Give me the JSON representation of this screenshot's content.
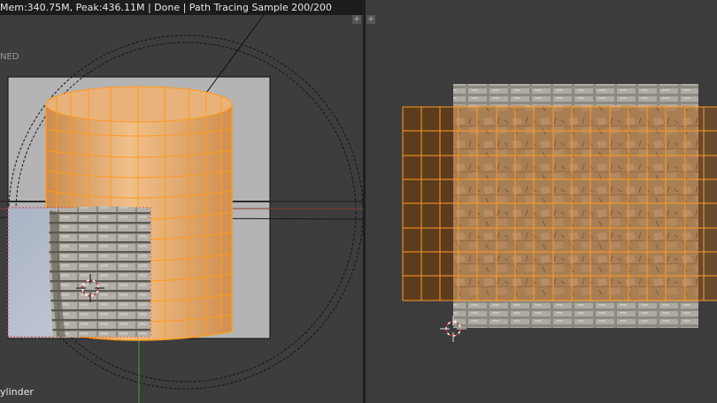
{
  "status_bar": {
    "text": "Mem:340.75M, Peak:436.11M | Done | Path Tracing Sample 200/200"
  },
  "viewport": {
    "mode_label": "NED",
    "object_name": "ylinder"
  },
  "corner_widget": {
    "glyph": "+"
  },
  "colors": {
    "wire": "#ff9a20",
    "wire_dark": "#c06010",
    "mesh_fill": "#e0a060",
    "uv_fill": "#a05a20",
    "stone": "#a09f96",
    "background": "#3d3d3d",
    "render_sky": "#b5bccb"
  },
  "icons": [
    "3d-cursor-icon",
    "uv-cursor-icon",
    "area-split-icon"
  ]
}
